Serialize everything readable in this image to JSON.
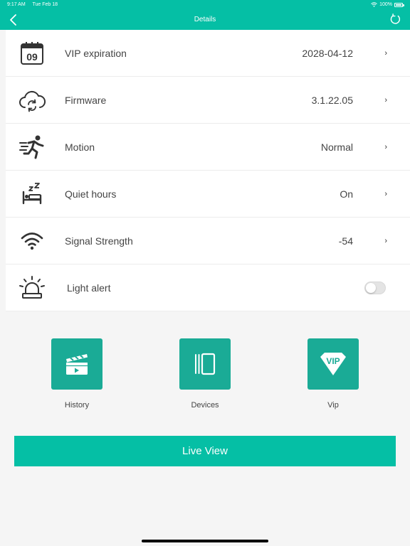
{
  "status_bar": {
    "time": "9:17 AM",
    "date": "Tue Feb 18",
    "battery": "100%"
  },
  "header": {
    "title": "Details"
  },
  "rows": [
    {
      "label": "VIP expiration",
      "value": "2028-04-12",
      "icon": "calendar-icon",
      "calendar_day": "09"
    },
    {
      "label": "Firmware",
      "value": "3.1.22.05",
      "icon": "cloud-sync-icon"
    },
    {
      "label": "Motion",
      "value": "Normal",
      "icon": "running-person-icon"
    },
    {
      "label": "Quiet hours",
      "value": "On",
      "icon": "sleeping-bed-icon"
    },
    {
      "label": "Signal Strength",
      "value": "-54",
      "icon": "wifi-icon"
    },
    {
      "label": "Light alert",
      "value": "",
      "icon": "siren-icon",
      "toggle_on": false
    }
  ],
  "actions": [
    {
      "label": "History",
      "icon": "clapperboard-icon"
    },
    {
      "label": "Devices",
      "icon": "devices-icon"
    },
    {
      "label": "Vip",
      "icon": "vip-diamond-icon",
      "badge_text": "VIP"
    }
  ],
  "live_view_label": "Live View",
  "colors": {
    "accent": "#05bfa5",
    "tile": "#1aab96",
    "text": "#444444",
    "background": "#f5f5f5"
  }
}
